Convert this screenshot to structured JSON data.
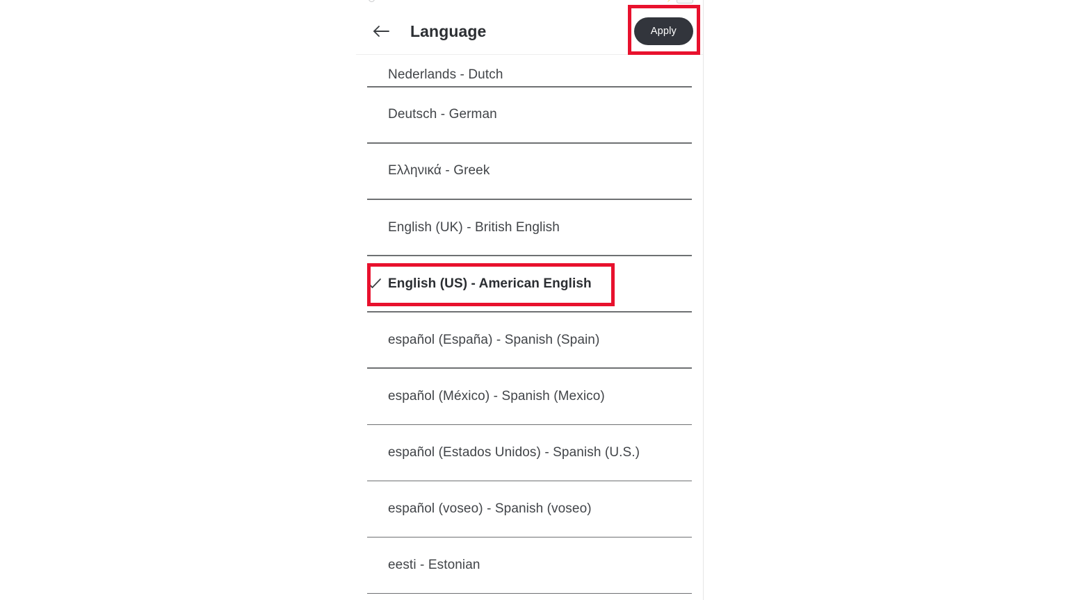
{
  "status_bar": {
    "left_text": "",
    "center_text": "",
    "battery_icon": "battery-icon",
    "bolt_icon": "charging-bolt-icon"
  },
  "header": {
    "back_icon": "arrow-left-icon",
    "title": "Language",
    "apply_label": "Apply"
  },
  "annotations": {
    "apply_box_color": "#e8112d",
    "selected_box_color": "#e8112d"
  },
  "list": {
    "check_icon": "check-icon",
    "items": [
      {
        "label": "Nederlands - Dutch",
        "selected": false,
        "clipped": true
      },
      {
        "label": "Deutsch - German",
        "selected": false,
        "clipped": false
      },
      {
        "label": "Ελληνικά - Greek",
        "selected": false,
        "clipped": false
      },
      {
        "label": "English (UK) - British English",
        "selected": false,
        "clipped": false
      },
      {
        "label": "English (US) - American English",
        "selected": true,
        "clipped": false
      },
      {
        "label": "español (España) - Spanish (Spain)",
        "selected": false,
        "clipped": false
      },
      {
        "label": "español (México) - Spanish (Mexico)",
        "selected": false,
        "clipped": false
      },
      {
        "label": "español (Estados Unidos) - Spanish (U.S.)",
        "selected": false,
        "clipped": false
      },
      {
        "label": "español (voseo) - Spanish (voseo)",
        "selected": false,
        "clipped": false
      },
      {
        "label": "eesti - Estonian",
        "selected": false,
        "clipped": false
      }
    ]
  },
  "colors": {
    "apply_button_bg": "#32353c",
    "apply_button_text": "#ffffff",
    "divider": "#6e7072",
    "text": "#414448",
    "annotation_red": "#e8112d"
  }
}
